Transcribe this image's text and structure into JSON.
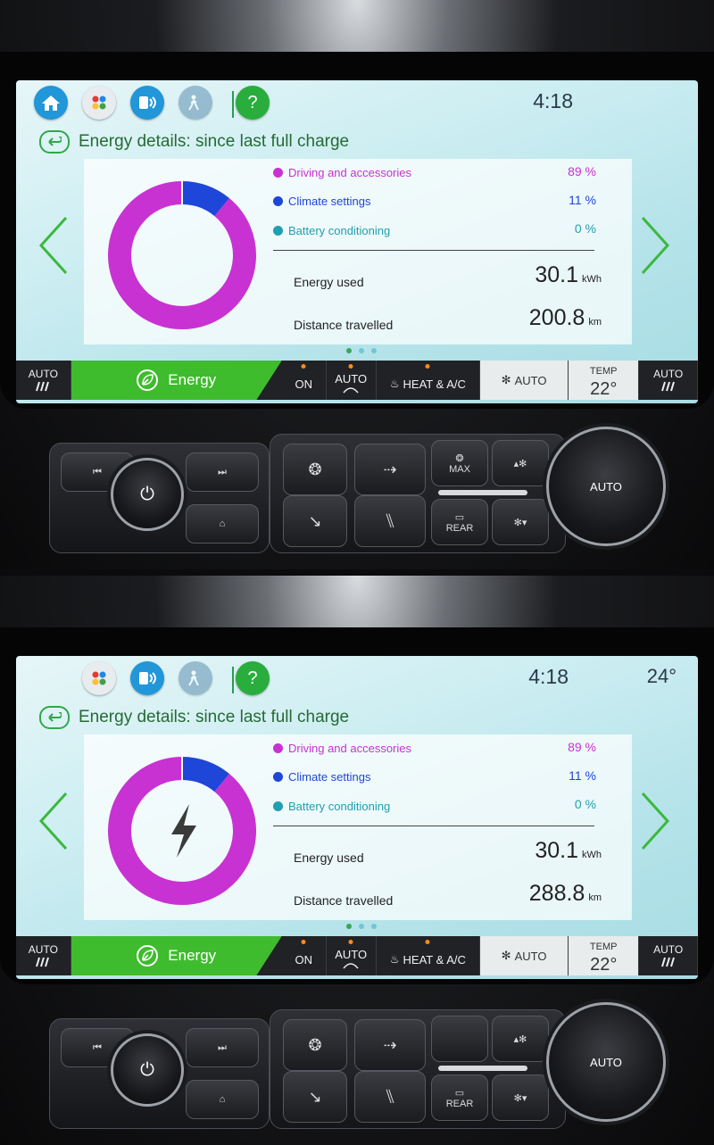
{
  "panels": [
    {
      "topbar": {
        "icons": [
          {
            "name": "home-icon"
          },
          {
            "name": "apps-icon"
          },
          {
            "name": "phone-icon"
          },
          {
            "name": "pedestrian-icon"
          },
          {
            "name": "help-icon",
            "label": "?"
          }
        ],
        "time": "4:18",
        "outside_temp": ""
      },
      "title": "Energy details: since last full charge",
      "legend": [
        {
          "label": "Driving and accessories",
          "value": "89 %",
          "color": "#c832d2"
        },
        {
          "label": "Climate settings",
          "value": "11 %",
          "color": "#1e46d8"
        },
        {
          "label": "Battery conditioning",
          "value": "0 %",
          "color": "#1f9fb0"
        }
      ],
      "energy_used": {
        "label": "Energy used",
        "value": "30.1",
        "unit": "kWh"
      },
      "distance": {
        "label": "Distance travelled",
        "value": "200.8",
        "unit": "km"
      },
      "center_icon": "",
      "pager_active": 0
    },
    {
      "topbar": {
        "icons": [
          {
            "name": "apps-icon"
          },
          {
            "name": "phone-icon"
          },
          {
            "name": "pedestrian-icon"
          },
          {
            "name": "help-icon",
            "label": "?"
          }
        ],
        "time": "4:18",
        "outside_temp": "24°"
      },
      "title": "Energy details: since last full charge",
      "legend": [
        {
          "label": "Driving and accessories",
          "value": "89 %",
          "color": "#c832d2"
        },
        {
          "label": "Climate settings",
          "value": "11 %",
          "color": "#1e46d8"
        },
        {
          "label": "Battery conditioning",
          "value": "0 %",
          "color": "#1f9fb0"
        }
      ],
      "energy_used": {
        "label": "Energy used",
        "value": "30.1",
        "unit": "kWh"
      },
      "distance": {
        "label": "Distance travelled",
        "value": "288.8",
        "unit": "km"
      },
      "center_icon": "lightning-bolt-icon",
      "pager_active": 0
    }
  ],
  "climate": {
    "auto_left": "AUTO",
    "energy": "Energy",
    "on": "ON",
    "auto_recirc": "AUTO",
    "heat_ac": "HEAT & A/C",
    "fan_auto": "AUTO",
    "temp_label": "TEMP",
    "temp_value": "22°",
    "auto_right": "AUTO"
  },
  "console": {
    "max": "MAX",
    "rear": "REAR",
    "auto": "AUTO"
  },
  "chart_data": [
    {
      "type": "pie",
      "categories": [
        "Driving and accessories",
        "Climate settings",
        "Battery conditioning"
      ],
      "values": [
        89,
        11,
        0
      ]
    },
    {
      "type": "pie",
      "categories": [
        "Driving and accessories",
        "Climate settings",
        "Battery conditioning"
      ],
      "values": [
        89,
        11,
        0
      ]
    }
  ],
  "colors": {
    "accent_green": "#3fbb2e",
    "driving": "#c832d2",
    "climate": "#1e46d8",
    "battery": "#1f9fb0"
  }
}
